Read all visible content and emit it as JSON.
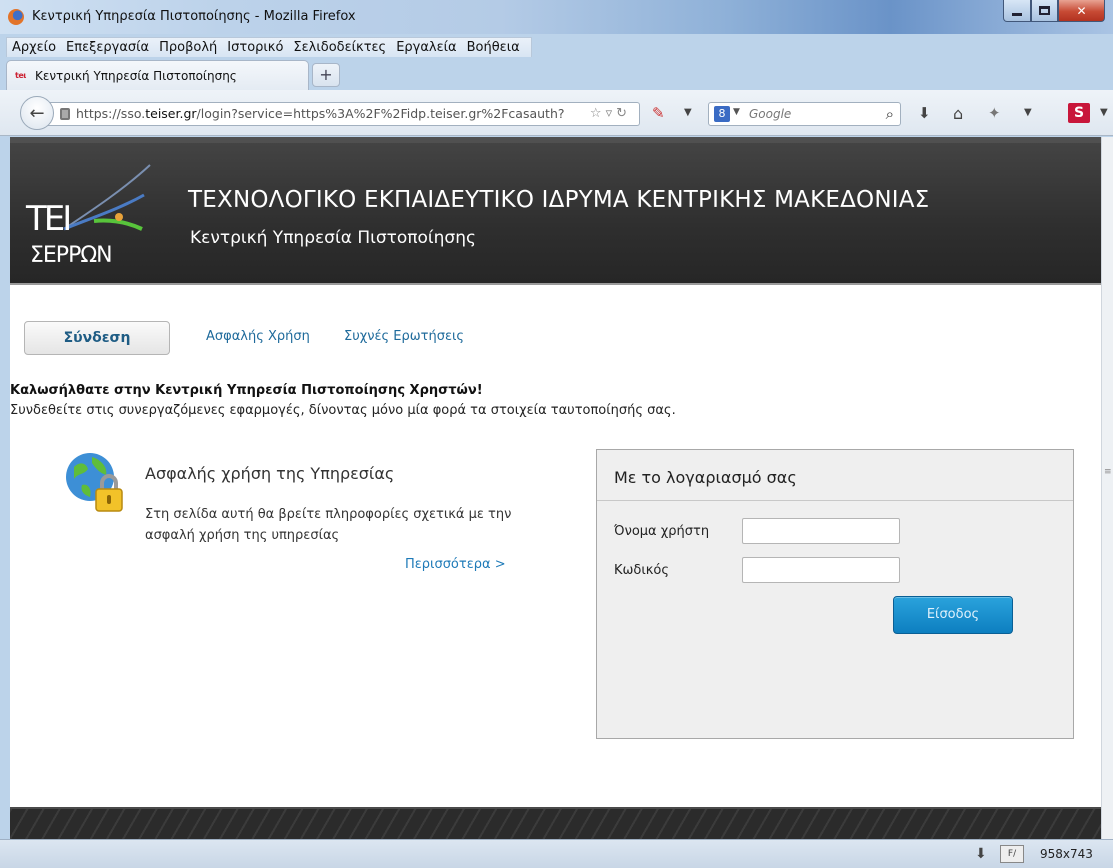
{
  "window": {
    "title": "Κεντρική Υπηρεσία Πιστοποίησης - Mozilla Firefox",
    "controls": [
      "minimize",
      "maximize",
      "close"
    ]
  },
  "menubar": {
    "items": [
      "Αρχείο",
      "Επεξεργασία",
      "Προβολή",
      "Ιστορικό",
      "Σελιδοδείκτες",
      "Εργαλεία",
      "Βοήθεια"
    ]
  },
  "tab": {
    "icon_text": "teι",
    "label": "Κεντρική Υπηρεσία Πιστοποίησης",
    "new_tab": "+"
  },
  "navbar": {
    "url_prefix": "https://sso.",
    "url_host": "teiser.gr",
    "url_rest": "/login?service=https%3A%2F%2Fidp.teiser.gr%2Fcasauth?",
    "search_engine": "8",
    "search_placeholder": "Google",
    "s_badge": "S"
  },
  "header": {
    "logo_tei": "ΤΕΙ",
    "logo_serron": "ΣΕΡΡΩΝ",
    "title": "ΤΕΧΝΟΛΟΓΙΚΟ ΕΚΠΑΙΔΕΥΤΙΚΟ ΙΔΡΥΜΑ ΚΕΝΤΡΙΚΗΣ ΜΑΚΕΔΟΝΙΑΣ",
    "subtitle": "Κεντρική Υπηρεσία Πιστοποίησης"
  },
  "nav": {
    "login": "Σύνδεση",
    "secure_use": "Ασφαλής Χρήση",
    "faq": "Συχνές Ερωτήσεις"
  },
  "welcome": {
    "title": "Καλωσήλθατε στην Κεντρική Υπηρεσία Πιστοποίησης Χρηστών!",
    "text": "Συνδεθείτε στις συνεργαζόμενες εφαρμογές, δίνοντας μόνο μία φορά τα στοιχεία ταυτοποίησής σας."
  },
  "secure": {
    "title": "Ασφαλής χρήση της Υπηρεσίας",
    "description": "Στη σελίδα αυτή θα βρείτε πληροφορίες σχετικά με την ασφαλή χρήση της υπηρεσίας",
    "more": "Περισσότερα >"
  },
  "login": {
    "title": "Με το λογαριασμό σας",
    "username_label": "Όνομα χρήστη",
    "password_label": "Κωδικός",
    "username_value": "",
    "password_value": "",
    "submit": "Είσοδος"
  },
  "statusbar": {
    "resolution": "958x743"
  },
  "colors": {
    "header_bg": "#333333",
    "link": "#1e6a9b",
    "button": "#1586c6"
  }
}
